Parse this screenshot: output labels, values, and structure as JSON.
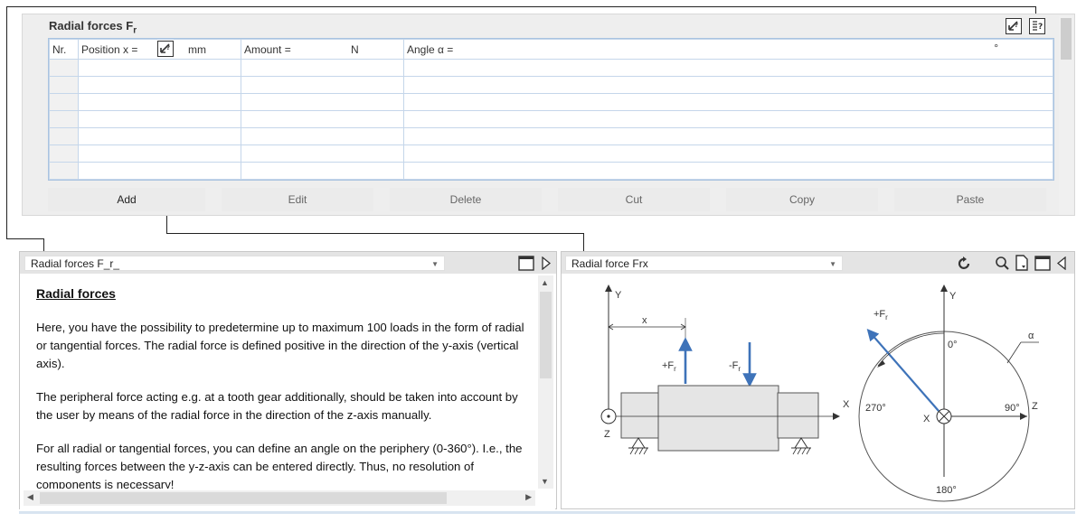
{
  "top_panel": {
    "title": "Radial forces F",
    "title_sub": "r",
    "columns": {
      "nr": "Nr.",
      "position": "Position x =",
      "position_unit": "mm",
      "amount": "Amount =",
      "amount_unit": "N",
      "angle": "Angle α =",
      "angle_unit": "°"
    },
    "buttons": {
      "add": "Add",
      "edit": "Edit",
      "delete": "Delete",
      "cut": "Cut",
      "copy": "Copy",
      "paste": "Paste"
    }
  },
  "help_panel": {
    "combo_value": "Radial forces F_r_",
    "heading": "Radial forces",
    "paragraphs": [
      "Here, you have the possibility to predetermine up to maximum 100 loads in the form of radial or tangential forces. The radial force is defined positive in the direction of the y-axis (vertical axis).",
      "The peripheral force acting e.g. at a tooth gear additionally, should be taken into account by the user by means of the radial force in the direction of the z-axis manually.",
      "For all radial or tangential forces, you can define an angle on the periphery (0-360°). I.e., the resulting forces between the y-z-axis can be entered directly. Thus, no resolution of components is necessary!"
    ]
  },
  "graphic_panel": {
    "combo_value": "Radial force Frx",
    "labels": {
      "y1": "Y",
      "x_dim": "x",
      "plus_f": "+F",
      "minus_f": "-F",
      "f_sub": "r",
      "x_axis": "X",
      "z_axis": "Z",
      "y2": "Y",
      "plus_f2": "+F",
      "alpha": "α",
      "deg0": "0°",
      "deg90": "90°",
      "deg180": "180°",
      "deg270": "270°",
      "x_center": "X",
      "z2": "Z"
    }
  },
  "icons": {
    "edit": "edit-icon",
    "help": "help-icon",
    "window": "window-icon",
    "play": "triangle-right-icon",
    "refresh": "refresh-icon",
    "zoom": "magnifier-icon",
    "doc": "document-icon",
    "collapse": "triangle-left-icon"
  }
}
